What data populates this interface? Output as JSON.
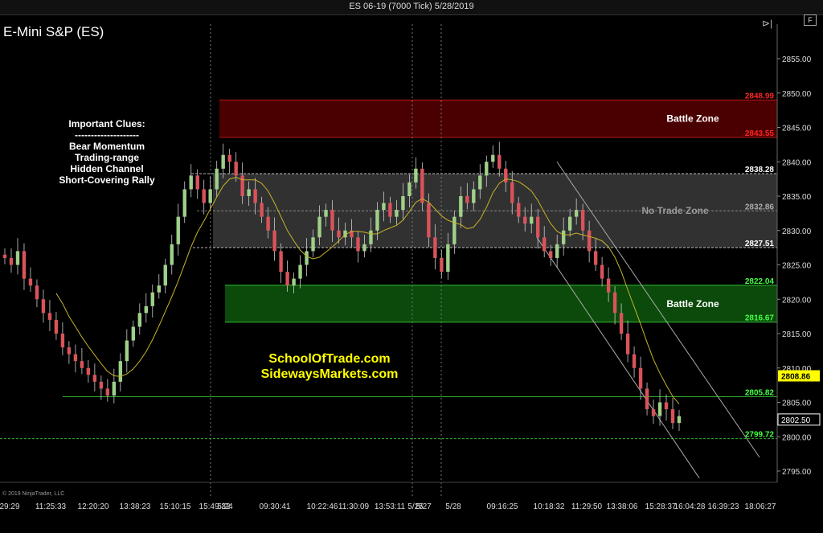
{
  "window": {
    "title": "ES 06-19 (7000 Tick)  5/28/2019",
    "instrument": "E-Mini S&P (ES)",
    "settings_glyph": "F",
    "collapse_glyph": "⊳|",
    "copyright": "© 2019 NinjaTrader, LLC"
  },
  "annotations": {
    "clues": [
      "Important Clues:",
      "--------------------",
      "Bear Momentum",
      "Trading-range",
      "Hidden Channel",
      "Short-Covering Rally"
    ],
    "promo": [
      "SchoolOfTrade.com",
      "SidewaysMarkets.com"
    ]
  },
  "chart_data": {
    "type": "candlestick",
    "ylim": [
      2792,
      2860
    ],
    "y_ticks": [
      2795,
      2800,
      2805,
      2810,
      2815,
      2820,
      2825,
      2830,
      2835,
      2840,
      2845,
      2850,
      2855
    ],
    "x_tick_labels": [
      "29:29",
      "11:25:33",
      "12:20:20",
      "13:38:23",
      "15:10:15",
      "15:49:32",
      "5/24",
      "09:30:41",
      "10:22:46",
      "11:30:09",
      "13:53:11",
      "5/25",
      "5/27",
      "5/28",
      "09:16:25",
      "10:18:32",
      "11:29:50",
      "13:38:06",
      "15:28:37",
      "16:04:28",
      "16:39:23",
      "18:06:27"
    ],
    "session_breaks": [
      "5/24",
      "5/27",
      "5/28"
    ],
    "zones": [
      {
        "name": "Battle Zone",
        "label": "Battle Zone",
        "low": 2843.55,
        "high": 2848.99,
        "color": "#4a0000",
        "label_color": "#ff2222"
      },
      {
        "name": "No Trade Zone",
        "label": "No Trade Zone",
        "low": 2827.51,
        "high": 2838.28,
        "color": "#3a3a3a",
        "label_color": "#ffffff"
      },
      {
        "name": "Battle Zone",
        "label": "Battle Zone",
        "low": 2816.67,
        "high": 2822.04,
        "color": "#0b4a0b",
        "label_color": "#44ff44"
      }
    ],
    "levels": [
      {
        "value": 2848.99,
        "label": "2848.99",
        "color": "#ff2222"
      },
      {
        "value": 2843.55,
        "label": "2843.55",
        "color": "#ff2222"
      },
      {
        "value": 2838.28,
        "label": "2838.28",
        "color": "#ffffff"
      },
      {
        "value": 2832.86,
        "label": "2832.86",
        "color": "#aaaaaa"
      },
      {
        "value": 2827.51,
        "label": "2827.51",
        "color": "#ffffff"
      },
      {
        "value": 2822.04,
        "label": "2822.04",
        "color": "#44ff44"
      },
      {
        "value": 2816.67,
        "label": "2816.67",
        "color": "#44ff44"
      },
      {
        "value": 2805.82,
        "label": "2805.82",
        "color": "#44ff44"
      },
      {
        "value": 2799.72,
        "label": "2799.72",
        "color": "#44ff44"
      }
    ],
    "price_tags": [
      {
        "value": 2808.86,
        "label": "2808.86",
        "style": "filled"
      },
      {
        "value": 2802.5,
        "label": "2802.50",
        "style": "outline"
      }
    ],
    "closes": [
      2826,
      2825,
      2827,
      2823,
      2822,
      2820,
      2818,
      2817,
      2815,
      2813,
      2812,
      2811,
      2810,
      2809,
      2808,
      2807,
      2806,
      2808,
      2811,
      2814,
      2816,
      2818,
      2819,
      2821,
      2822,
      2825,
      2828,
      2832,
      2836,
      2838,
      2836,
      2834,
      2836,
      2839,
      2841,
      2840,
      2838,
      2835,
      2836,
      2834,
      2832,
      2830,
      2827,
      2824,
      2822,
      2823,
      2825,
      2827,
      2829,
      2832,
      2833,
      2830,
      2829,
      2830,
      2829,
      2827,
      2828,
      2830,
      2833,
      2834,
      2832,
      2833,
      2835,
      2837,
      2839,
      2834,
      2829,
      2826,
      2824,
      2828,
      2832,
      2835,
      2834,
      2836,
      2838,
      2840,
      2841,
      2839,
      2837,
      2834,
      2832,
      2831,
      2832,
      2829,
      2827,
      2826,
      2828,
      2830,
      2832,
      2833,
      2830,
      2827,
      2825,
      2823,
      2821,
      2818,
      2815,
      2812,
      2810,
      2807,
      2804,
      2803,
      2805,
      2804,
      2802,
      2803
    ]
  }
}
